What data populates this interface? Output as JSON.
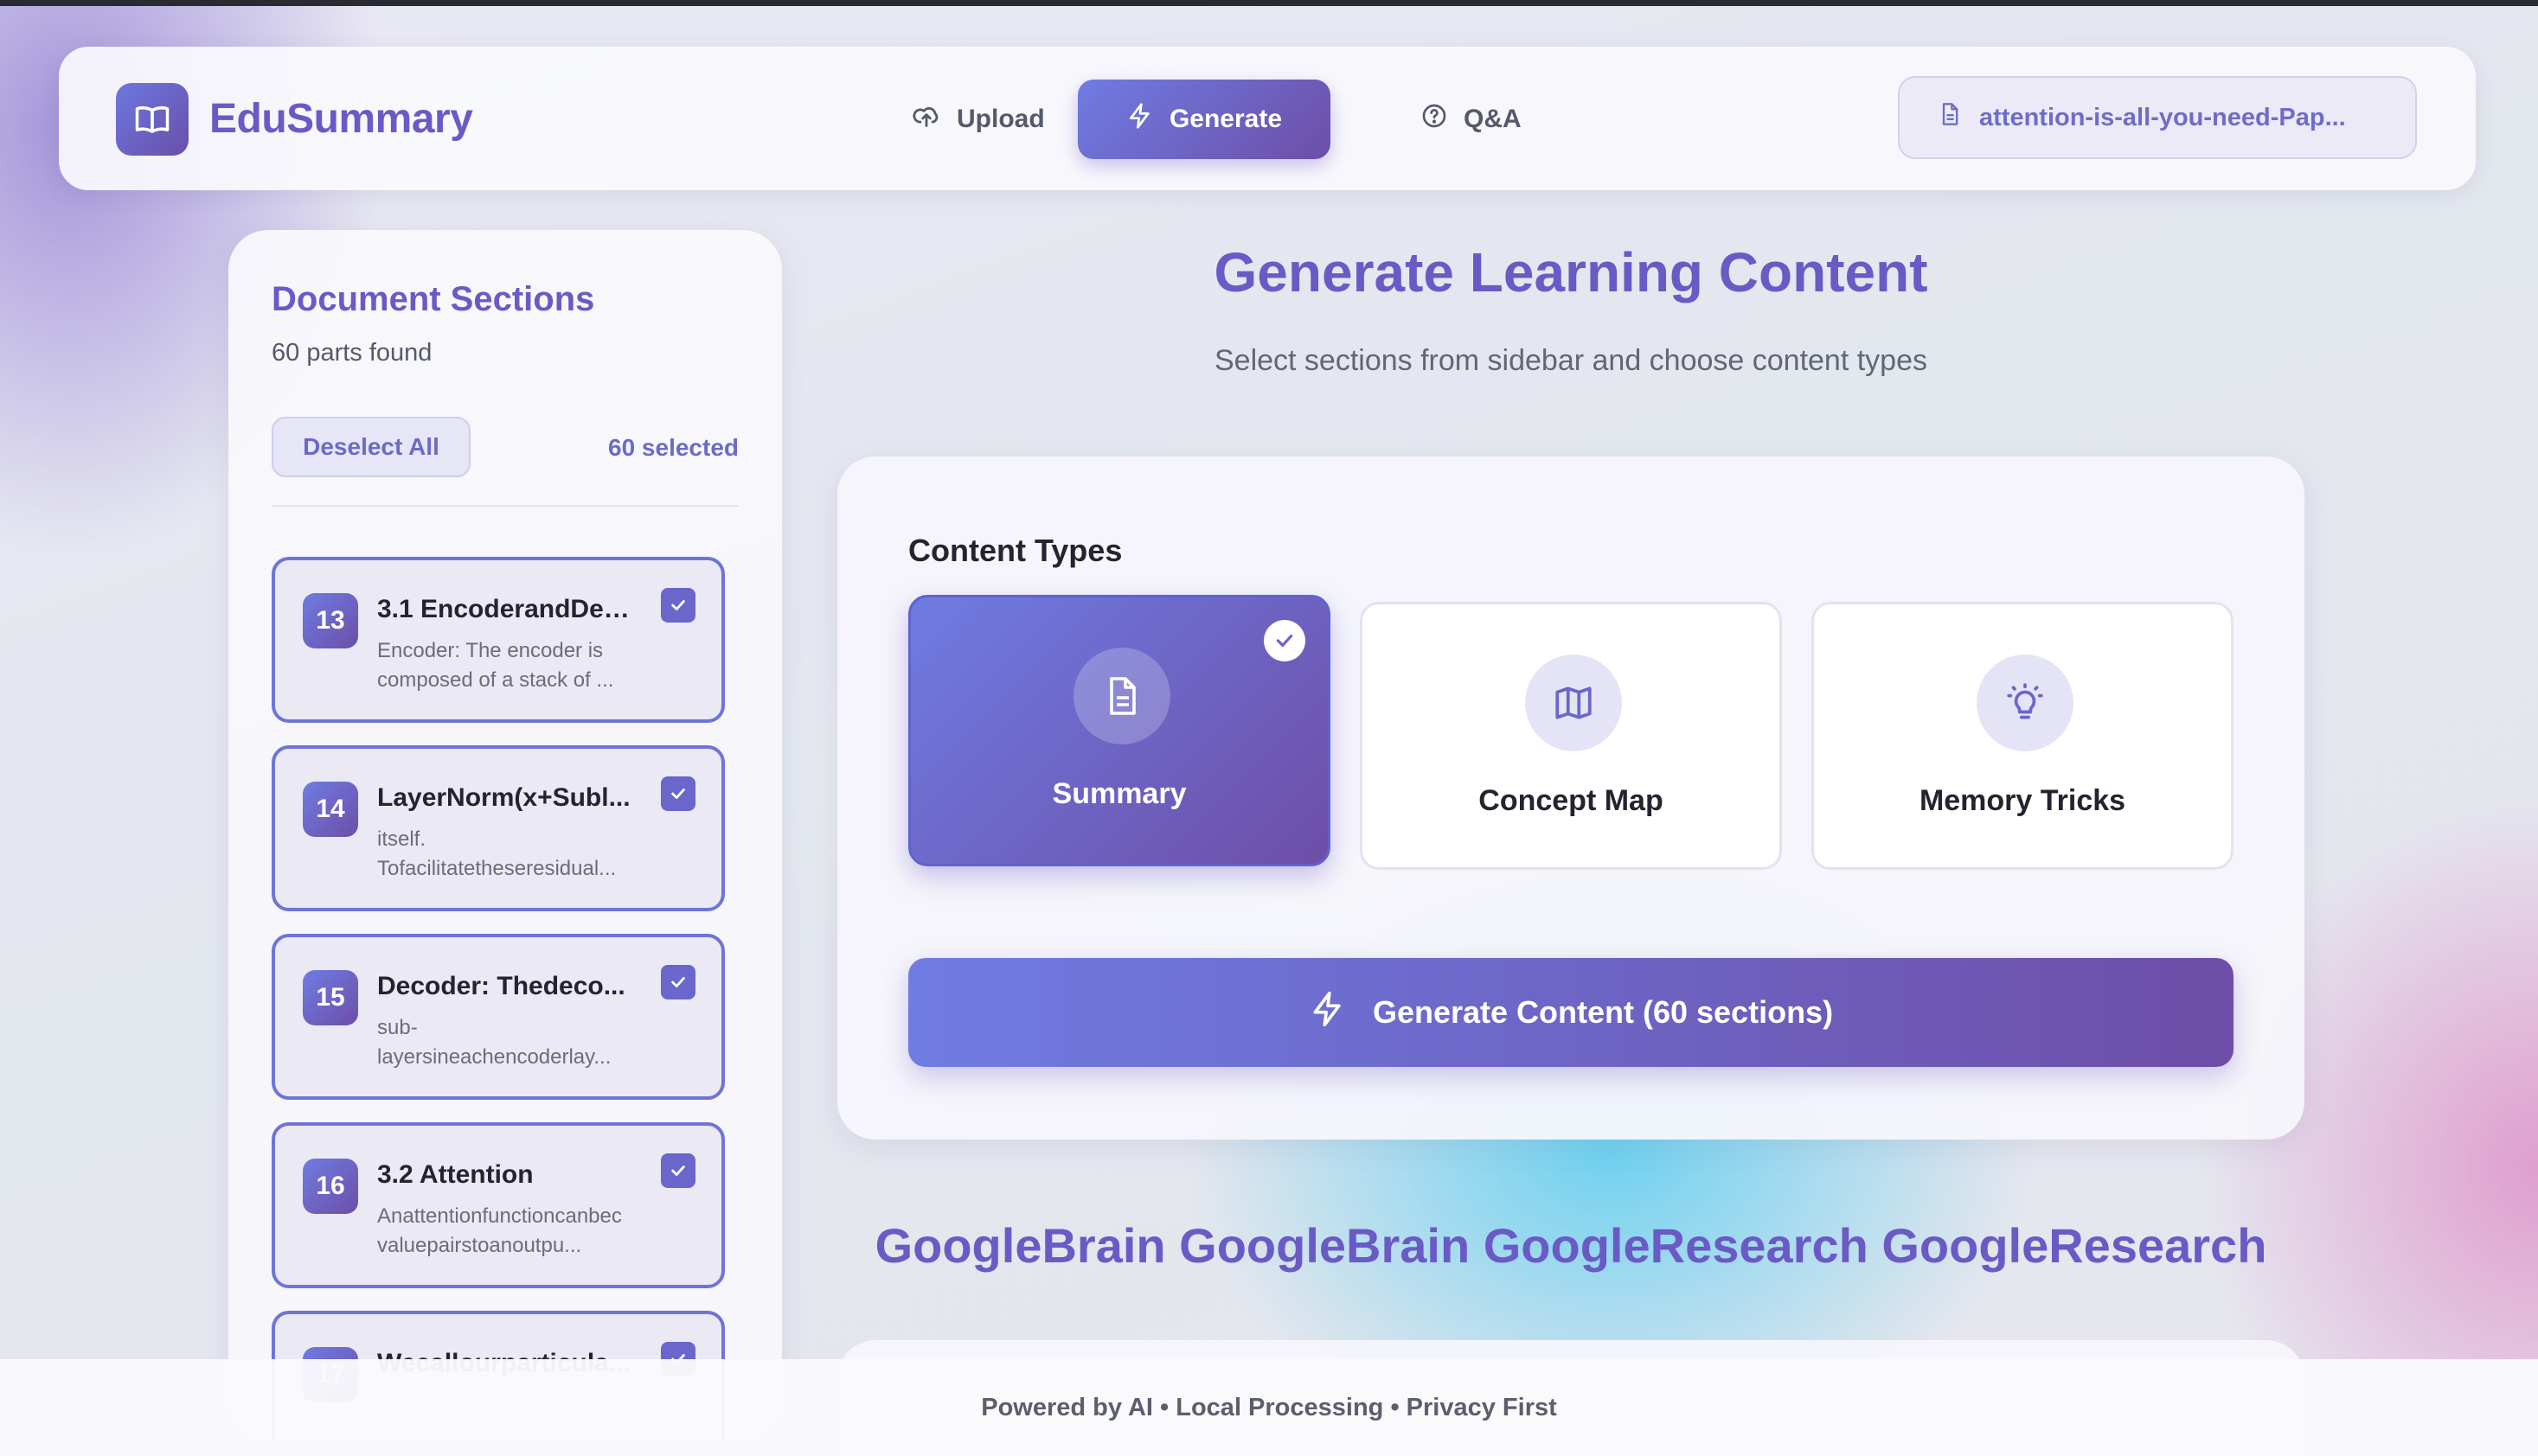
{
  "app": {
    "name": "EduSummary",
    "brand_color": "#6a5ac6",
    "accent_gradient": [
      "#6f7ce2",
      "#6d4ea8"
    ]
  },
  "nav": {
    "items": [
      {
        "label": "Upload",
        "icon": "cloud-upload-icon",
        "active": false
      },
      {
        "label": "Generate",
        "icon": "lightning-icon",
        "active": true
      },
      {
        "label": "Q&A",
        "icon": "help-circle-icon",
        "active": false
      }
    ],
    "file_chip": {
      "label": "attention-is-all-you-need-Pap...",
      "icon": "document-icon"
    }
  },
  "sidebar": {
    "title": "Document Sections",
    "subtitle": "60 parts found",
    "deselect_label": "Deselect All",
    "selected_count": "60 selected",
    "sections": [
      {
        "num": "13",
        "title": "3.1 EncoderandDec...",
        "desc": "Encoder: The encoder is composed of a stack of ...",
        "checked": true
      },
      {
        "num": "14",
        "title": "LayerNorm(x+Subl...",
        "desc": "itself. Tofacilitatetheseresidual...",
        "checked": true
      },
      {
        "num": "15",
        "title": "Decoder: Thedeco...",
        "desc": "sub-layersineachencoderlay...",
        "checked": true
      },
      {
        "num": "16",
        "title": "3.2 Attention",
        "desc": "Anattentionfunctioncanbec valuepairstoanoutpu...",
        "checked": true
      },
      {
        "num": "17",
        "title": "Wecallourparticula...",
        "desc": "",
        "checked": true
      }
    ]
  },
  "main": {
    "title": "Generate Learning Content",
    "subtitle": "Select sections from sidebar and choose content types",
    "content_types_label": "Content Types",
    "content_types": [
      {
        "label": "Summary",
        "icon": "document-icon",
        "selected": true
      },
      {
        "label": "Concept Map",
        "icon": "map-icon",
        "selected": false
      },
      {
        "label": "Memory Tricks",
        "icon": "lightbulb-icon",
        "selected": false
      }
    ],
    "generate_button": "Generate Content (60 sections)",
    "authors_heading": "GoogleBrain GoogleBrain GoogleResearch GoogleResearch"
  },
  "footer": {
    "text": "Powered by AI • Local Processing • Privacy First"
  }
}
